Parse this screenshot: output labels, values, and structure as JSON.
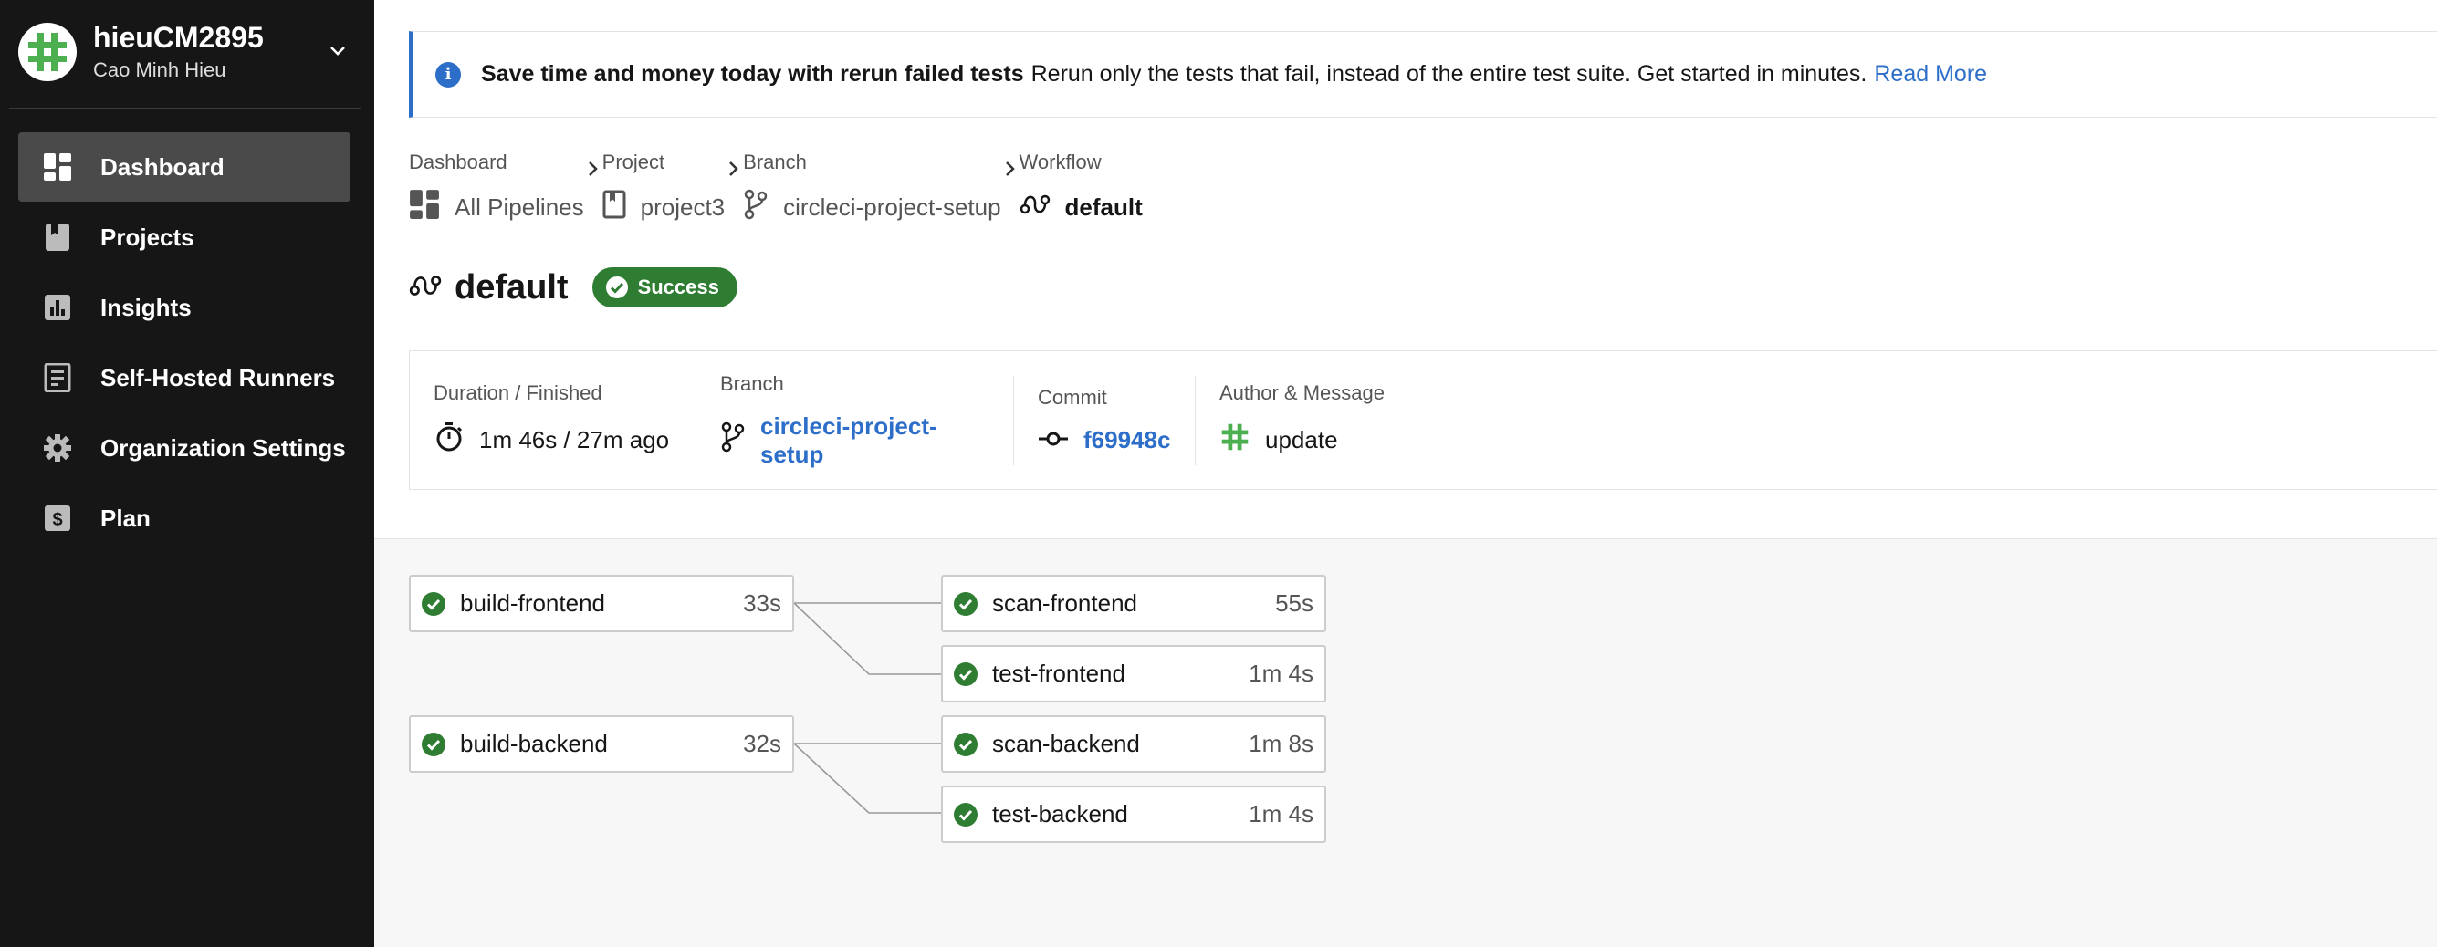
{
  "org": {
    "name": "hieuCM2895",
    "user": "Cao Minh Hieu"
  },
  "nav": [
    {
      "label": "Dashboard",
      "icon": "dashboard-icon",
      "active": true
    },
    {
      "label": "Projects",
      "icon": "projects-icon"
    },
    {
      "label": "Insights",
      "icon": "insights-icon"
    },
    {
      "label": "Self-Hosted Runners",
      "icon": "runners-icon"
    },
    {
      "label": "Organization Settings",
      "icon": "gear-icon"
    },
    {
      "label": "Plan",
      "icon": "plan-icon"
    }
  ],
  "banner": {
    "bold": "Save time and money today with rerun failed tests",
    "text": "Rerun only the tests that fail, instead of the entire test suite. Get started in minutes.",
    "link": "Read More"
  },
  "breadcrumb": [
    {
      "caption": "Dashboard",
      "value": "All Pipelines",
      "icon": "pipelines-icon"
    },
    {
      "caption": "Project",
      "value": "project3",
      "icon": "bookmark-icon"
    },
    {
      "caption": "Branch",
      "value": "circleci-project-setup",
      "icon": "branch-icon"
    },
    {
      "caption": "Workflow",
      "value": "default",
      "icon": "workflow-icon"
    }
  ],
  "workflow": {
    "title": "default",
    "status": "Success",
    "status_color": "#2f7d32"
  },
  "info": {
    "duration_caption": "Duration / Finished",
    "duration": "1m 46s / 27m ago",
    "branch_caption": "Branch",
    "branch": "circleci-project-setup",
    "commit_caption": "Commit",
    "commit": "f69948c",
    "author_caption": "Author & Message",
    "message": "update"
  },
  "jobs": [
    {
      "name": "build-frontend",
      "duration": "33s"
    },
    {
      "name": "scan-frontend",
      "duration": "55s"
    },
    {
      "name": "test-frontend",
      "duration": "1m 4s"
    },
    {
      "name": "build-backend",
      "duration": "32s"
    },
    {
      "name": "scan-backend",
      "duration": "1m 8s"
    },
    {
      "name": "test-backend",
      "duration": "1m 4s"
    }
  ],
  "colors": {
    "accent": "#2d6ec9",
    "success": "#2f7d32",
    "sidebar": "#161616"
  }
}
